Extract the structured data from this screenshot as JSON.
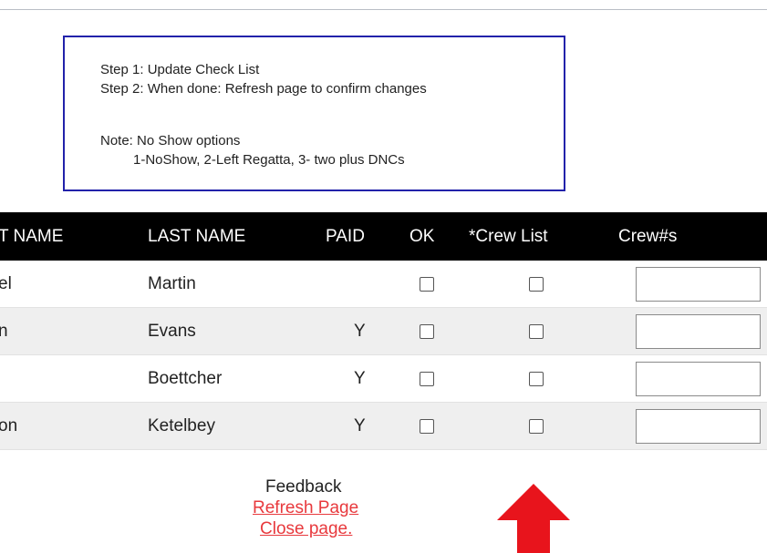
{
  "instructions": {
    "step1": "Step 1: Update Check List",
    "step2": "Step 2: When done: Refresh page to confirm changes",
    "note": "Note: No Show options",
    "options": "1-NoShow, 2-Left Regatta, 3- two plus DNCs"
  },
  "table": {
    "headers": {
      "first_name": "T NAME",
      "last_name": "LAST NAME",
      "paid": "PAID",
      "ok": "OK",
      "crew_list": "*Crew List",
      "crew_nums": "Crew#s"
    },
    "rows": [
      {
        "first": "el",
        "last": "Martin",
        "paid": "",
        "crew_value": ""
      },
      {
        "first": "n",
        "last": "Evans",
        "paid": "Y",
        "crew_value": ""
      },
      {
        "first": "",
        "last": "Boettcher",
        "paid": "Y",
        "crew_value": ""
      },
      {
        "first": "on",
        "last": "Ketelbey",
        "paid": "Y",
        "crew_value": ""
      }
    ]
  },
  "footer": {
    "feedback": "Feedback",
    "refresh_link": "Refresh Page",
    "close_link": "Close page."
  },
  "colors": {
    "link": "#e8393d",
    "arrow": "#e8141c",
    "header_bg": "#000000",
    "box_border": "#2222aa"
  },
  "icons": {
    "arrow": "up-arrow-icon"
  }
}
